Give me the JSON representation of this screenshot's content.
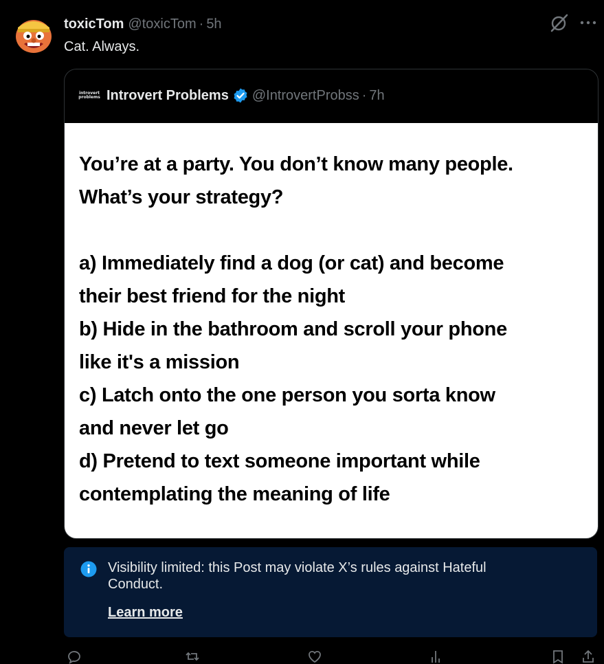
{
  "post": {
    "author_name": "toxicTom",
    "author_handle": "@toxicTom",
    "separator": "·",
    "time": "5h",
    "text": "Cat. Always."
  },
  "top_actions": {
    "icons": [
      "grok-icon",
      "more-icon"
    ]
  },
  "quote": {
    "avatar_text_line1": "introvert",
    "avatar_text_line2": "problems",
    "author_name": "Introvert Problems",
    "verified": true,
    "author_handle": "@IntrovertProbss",
    "separator": "·",
    "time": "7h",
    "media_lines": [
      "You’re at a party. You don’t know many people.",
      "What’s your strategy?",
      "a) Immediately find a dog (or cat) and become",
      "their best friend for the night",
      "b) Hide in the bathroom and scroll your phone",
      "like it's a mission",
      "c) Latch onto the one person you sorta know",
      "and never let go",
      "d) Pretend to text someone important while",
      "contemplating the meaning of life"
    ]
  },
  "notice": {
    "text": "Visibility limited: this Post may violate X’s rules against Hateful Conduct.",
    "link_label": "Learn more",
    "icon": "info-icon"
  },
  "colors": {
    "background": "#000000",
    "text_primary": "#e7e9ea",
    "text_secondary": "#71767b",
    "border": "#2f3336",
    "verified_blue": "#1d9bf0",
    "notice_background": "#061934"
  },
  "action_bar": {
    "icons": [
      "reply-icon",
      "repost-icon",
      "like-icon",
      "views-icon",
      "bookmark-icon",
      "share-icon"
    ]
  }
}
